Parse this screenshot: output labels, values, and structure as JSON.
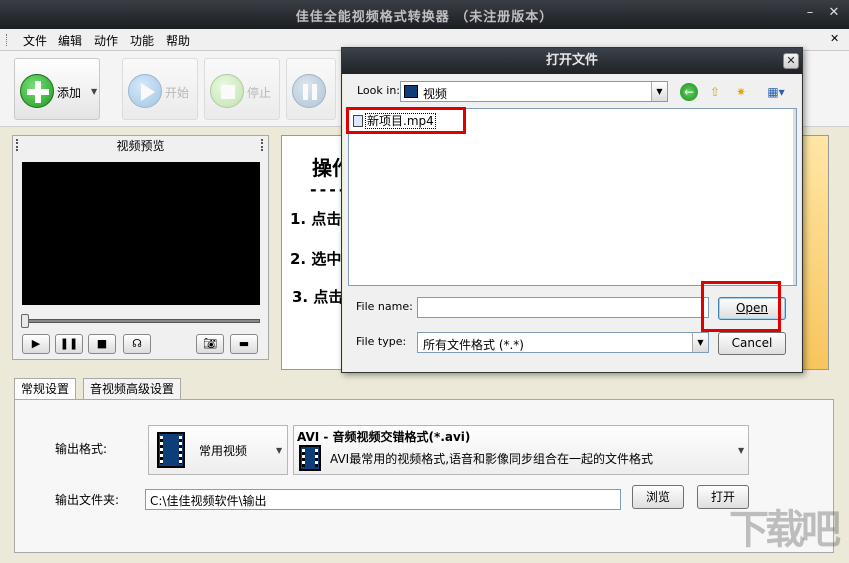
{
  "window": {
    "title": "佳佳全能视频格式转换器 （未注册版本）"
  },
  "menu": [
    "文件",
    "编辑",
    "动作",
    "功能",
    "帮助"
  ],
  "toolbar": {
    "add": "添加",
    "start": "开始",
    "stop": "停止"
  },
  "preview": {
    "title": "视频预览"
  },
  "instructions": {
    "heading": "操作",
    "dashes": "----",
    "steps": [
      "1. 点击",
      "2. 选中",
      "3. 点击"
    ]
  },
  "settings": {
    "tabs": [
      "常规设置",
      "音视频高级设置"
    ],
    "output_format_label": "输出格式:",
    "output_format_value": "常用视频",
    "format_name": "AVI - 音频视频交错格式(*.avi)",
    "format_desc": "AVI最常用的视频格式,语音和影像同步组合在一起的文件格式",
    "output_folder_label": "输出文件夹:",
    "output_folder_value": "C:\\佳佳视频软件\\输出",
    "browse": "浏览",
    "open": "打开"
  },
  "dialog": {
    "title": "打开文件",
    "look_in_label": "Look in:",
    "look_in_value": "视频",
    "files": [
      "新项目.mp4"
    ],
    "file_name_label": "File name:",
    "file_name_value": "",
    "file_type_label": "File type:",
    "file_type_value": "所有文件格式 (*.*)",
    "open_button": "Open",
    "cancel_button": "Cancel"
  },
  "colors": {
    "highlight": "#e00000",
    "add_green": "#2fb52f",
    "disabled_blue": "#6fa8dc"
  }
}
